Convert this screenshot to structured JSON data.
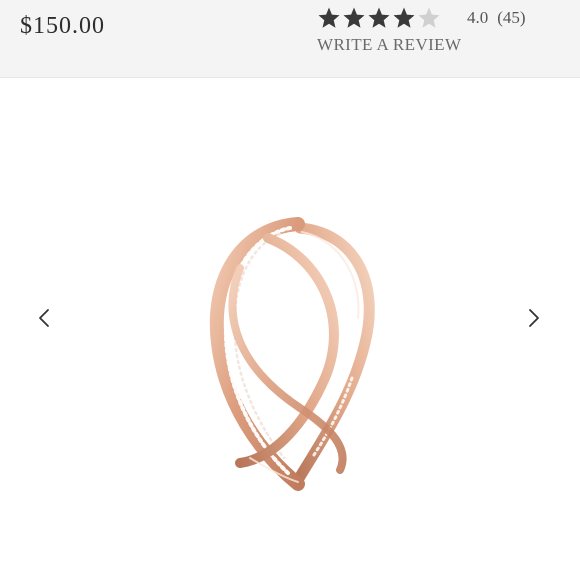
{
  "product": {
    "price": "$150.00",
    "rating_value": "4.0",
    "rating_count": "(45)",
    "rating_stars": 4,
    "rating_max": 5,
    "write_review_label": "WRITE A REVIEW"
  },
  "colors": {
    "header_background": "#f4f4f4",
    "star_filled": "#3a3a3a",
    "star_empty": "#d0d0d0",
    "ring_rose_gold": "#e0a78a"
  },
  "icons": {
    "star": "star-icon",
    "previous": "chevron-left-icon",
    "next": "chevron-right-icon"
  }
}
